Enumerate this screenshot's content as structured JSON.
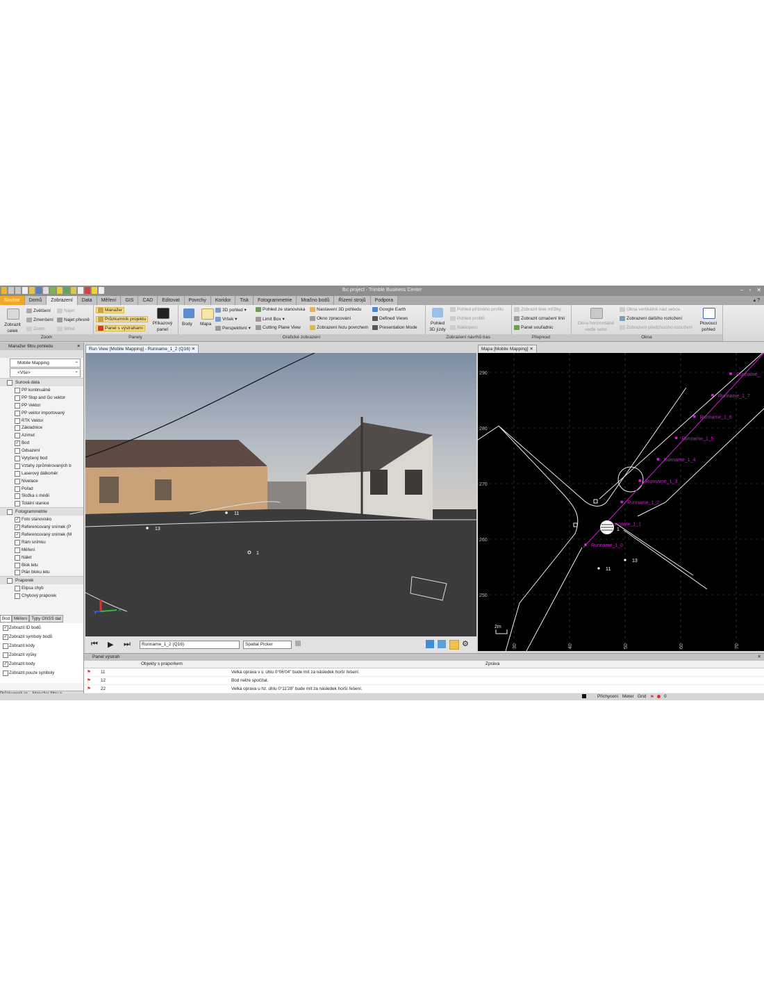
{
  "window": {
    "title": "tbc project - Trimble Business Center",
    "controls": [
      "–",
      "▫",
      "✕"
    ]
  },
  "ribbon_tabs": [
    "Soubor",
    "Domů",
    "Zobrazení",
    "Data",
    "Měření",
    "GIS",
    "CAD",
    "Editovat",
    "Povrchy",
    "Koridor",
    "Tisk",
    "Fotogrammetrie",
    "Mračno bodů",
    "Řízení strojů",
    "Podpora"
  ],
  "ribbon_right": "▴  ?",
  "ribbon": {
    "zoom": {
      "title": "Zoom",
      "show_all": "Zobrazit celek",
      "zoom_in": "Zvětšení",
      "zoom_out": "Zmenšení",
      "zoom": "Zoom",
      "pan": "Najet",
      "pan_exact": "Najet přesně",
      "center": "Střed"
    },
    "panels": {
      "title": "Panely",
      "manager": "Manažer",
      "explorer": "Průzkumník projektu",
      "warnings": "Panel s výstrahami",
      "command": "Příkazový panel"
    },
    "graphic": {
      "title": "Grafické zobrazení",
      "points": "Body",
      "map": "Mapa",
      "view3d": "3D pohled",
      "top": "Vršek",
      "perspective": "Perspektivní",
      "station_view": "Pohled ze stanoviska",
      "limit_box": "Limit Box",
      "cutting_plane": "Cutting Plane View",
      "settings3d": "Nastavení 3D pohledu",
      "processing": "Okno zpracování",
      "surface_cut": "Zobrazení řezu povrchem",
      "google_earth": "Google Earth",
      "defined_views": "Defined Views",
      "presentation": "Presentation Mode"
    },
    "route": {
      "title": "Zobrazení návrhů tras",
      "drive3d": "Pohled 3D jízdy",
      "cross": "Pohled příčného profilu",
      "profile": "Pohled profilů",
      "tilt": "Naklopení"
    },
    "switch": {
      "title": "Přepnout",
      "grid": "Zobrazit linie mřížky",
      "coords": "Zobrazit označení linií",
      "panel_coords": "Panel souřadnic"
    },
    "window": {
      "title": "Okna",
      "horizontal": "Okna horizontálně vedle sebe",
      "vertical": "Okna vertikálně nad sebou",
      "next_layout": "Zobrazení dalšího rozložení",
      "prev_layout": "Zobrazení předchozího rozložení",
      "floating": "Plovoucí pohled"
    }
  },
  "left_panel": {
    "title": "Manažer filtru pohledu",
    "filter": "Mobile Mapping",
    "all": "<Vše>",
    "categories": [
      {
        "name": "Surová data",
        "items": [
          {
            "label": "PP kontinuálně",
            "checked": false
          },
          {
            "label": "PP Stop and Go vektor",
            "checked": false
          },
          {
            "label": "PP Vektor",
            "checked": false
          },
          {
            "label": "PP vektor importovaný",
            "checked": false
          },
          {
            "label": "RTK Vektor",
            "checked": false
          },
          {
            "label": "Základnice",
            "checked": false
          },
          {
            "label": "Azimut",
            "checked": false
          },
          {
            "label": "Bod",
            "checked": true
          },
          {
            "label": "Odsazení",
            "checked": false
          },
          {
            "label": "Vytyčený bod",
            "checked": false
          },
          {
            "label": "Vztahy zprůměrovaných b",
            "checked": false
          },
          {
            "label": "Laserový dálkoměr",
            "checked": false
          },
          {
            "label": "Nivelace",
            "checked": false
          },
          {
            "label": "Pořad",
            "checked": false
          },
          {
            "label": "Složka s médii",
            "checked": false
          },
          {
            "label": "Totální stanice",
            "checked": false
          }
        ]
      },
      {
        "name": "Fotogrammetrie",
        "items": [
          {
            "label": "Foto stanovisko",
            "checked": true
          },
          {
            "label": "Referencovaný snímek (P",
            "checked": true
          },
          {
            "label": "Referencovaný snímek (M",
            "checked": true
          },
          {
            "label": "Rám snímku",
            "checked": false
          },
          {
            "label": "Měření",
            "checked": false
          },
          {
            "label": "Nálet",
            "checked": false
          },
          {
            "label": "Blok letu",
            "checked": false
          },
          {
            "label": "Plán bloku letu",
            "checked": false
          }
        ]
      },
      {
        "name": "Praporek",
        "items": [
          {
            "label": "Elipsa chyb",
            "checked": false
          },
          {
            "label": "Chybový praporek",
            "checked": false
          }
        ]
      }
    ],
    "tabs": [
      "Bod",
      "Měření",
      "Typy GNSS dat"
    ],
    "props": [
      {
        "label": "Zobrazit ID bodů",
        "checked": true
      },
      {
        "label": "Zobrazit symboly bodů",
        "checked": true
      },
      {
        "label": "Zobrazit kódy",
        "checked": false
      },
      {
        "label": "Zobrazit výšky",
        "checked": false
      },
      {
        "label": "Zobrazit body",
        "checked": true
      },
      {
        "label": "Zobrazit pouze symboly",
        "checked": false
      }
    ],
    "bottom_tabs": [
      "Průzkumník pr...",
      "Manažer filtru p..."
    ]
  },
  "run_view": {
    "tab": "Run View [Mobile Mapping] - Runname_1_2 (Q16)",
    "labels": [
      "11",
      "13",
      "1"
    ],
    "run_select": "Runname_1_2 (Q16)",
    "picker": "Spatial Picker",
    "axis": {
      "x": "X",
      "y": "Y"
    }
  },
  "map_view": {
    "tab": "Mapa [Mobile Mapping]",
    "y_ticks": [
      "290",
      "280",
      "270",
      "260",
      "250"
    ],
    "x_ticks": [
      "30",
      "40",
      "50",
      "60",
      "70"
    ],
    "scale": "2m",
    "run_labels": [
      "Runname_",
      "Runname_1_7",
      "Runname_1_6",
      "Runname_1_5",
      "Runname_1_4",
      "Runname_1_3",
      "Runname_1_2",
      "Runname_1_1",
      "Runname_1_0"
    ],
    "points": [
      "1",
      "13",
      "11"
    ]
  },
  "warnings": {
    "title": "Panel výstrah",
    "col1": "Objekty s praporkem",
    "col2": "Zpráva",
    "rows": [
      {
        "id": "11",
        "msg": "Velká oprava v v. úhlu 0°06'04\" bude mít za následek horší řešení."
      },
      {
        "id": "12",
        "msg": "Bod nelze spočítat."
      },
      {
        "id": "22",
        "msg": "Velká oprava u hz. úhlu 0°11'28\" bude mít za následek horší řešení."
      }
    ]
  },
  "status": {
    "snap": "Přichycení",
    "unit": "Meter",
    "grid": "Grid",
    "count": "0"
  },
  "colors": {
    "accent": "#f0a82a",
    "run_line": "#d020d0"
  }
}
